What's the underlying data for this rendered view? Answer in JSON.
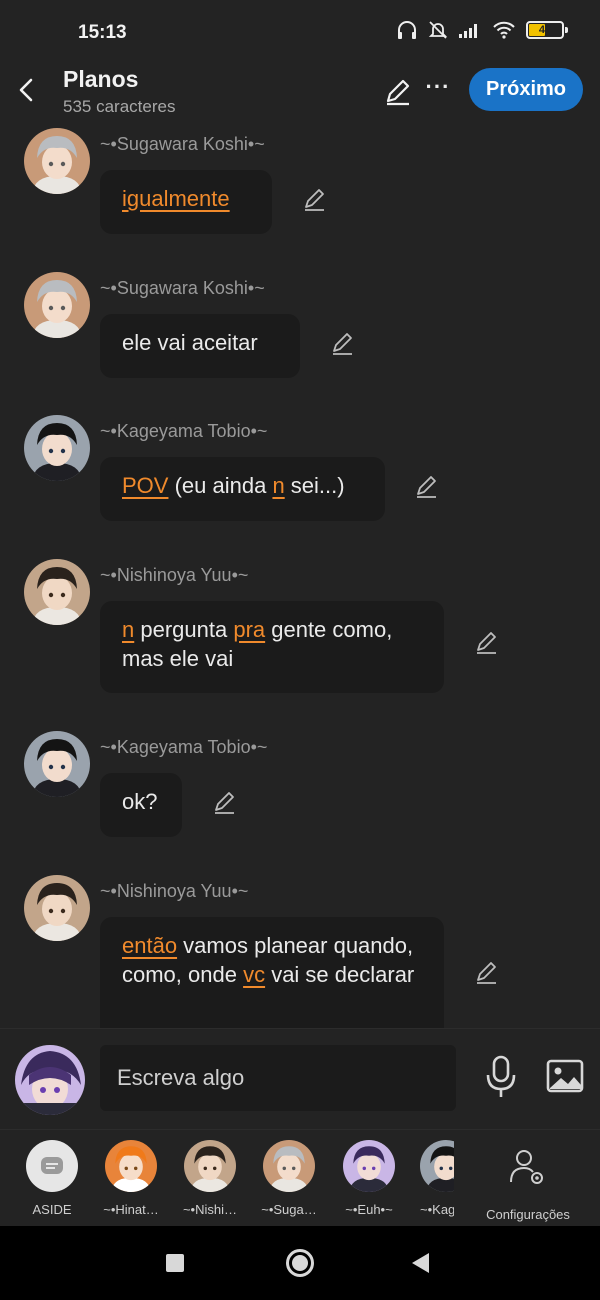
{
  "status": {
    "time": "15:13",
    "battery": "47",
    "battery_level": 0.47
  },
  "header": {
    "title": "Planos",
    "subtitle": "535 caracteres",
    "next_label": "Próximo"
  },
  "messages": [
    {
      "sender": "~•Sugawara Koshi•~",
      "avatar": "sugawara-avatar",
      "parts": [
        {
          "text": "igualmente",
          "hl": true
        }
      ]
    },
    {
      "sender": "~•Sugawara Koshi•~",
      "avatar": "sugawara-avatar",
      "parts": [
        {
          "text": "ele vai aceitar",
          "hl": false
        }
      ]
    },
    {
      "sender": "~•Kageyama Tobio•~",
      "avatar": "kageyama-avatar",
      "parts": [
        {
          "text": "POV",
          "hl": true
        },
        {
          "text": " (eu ainda ",
          "hl": false
        },
        {
          "text": "n",
          "hl": true
        },
        {
          "text": " sei...)",
          "hl": false
        }
      ]
    },
    {
      "sender": "~•Nishinoya Yuu•~",
      "avatar": "nishinoya-avatar",
      "parts": [
        {
          "text": "n",
          "hl": true
        },
        {
          "text": " pergunta ",
          "hl": false
        },
        {
          "text": "pra",
          "hl": true
        },
        {
          "text": " gente como, mas ele vai",
          "hl": false
        }
      ]
    },
    {
      "sender": "~•Kageyama Tobio•~",
      "avatar": "kageyama-avatar",
      "parts": [
        {
          "text": "ok?",
          "hl": false
        }
      ]
    },
    {
      "sender": "~•Nishinoya Yuu•~",
      "avatar": "nishinoya-avatar",
      "parts": [
        {
          "text": "então",
          "hl": true
        },
        {
          "text": " vamos planear quando, como, onde ",
          "hl": false
        },
        {
          "text": "vc",
          "hl": true
        },
        {
          "text": " vai se declarar",
          "hl": false
        }
      ]
    }
  ],
  "composer": {
    "placeholder": "Escreva algo"
  },
  "tabs": [
    {
      "label": "ASIDE",
      "icon": "chat-bubble-icon"
    },
    {
      "label": "~•Hinat…",
      "icon": "hinata-avatar"
    },
    {
      "label": "~•Nishi…",
      "icon": "nishinoya-avatar"
    },
    {
      "label": "~•Suga…",
      "icon": "sugawara-avatar"
    },
    {
      "label": "~•Euh•~",
      "icon": "euh-avatar"
    },
    {
      "label": "~•Kag",
      "icon": "kageyama-avatar"
    }
  ],
  "config_label": "Configurações",
  "colors": {
    "accent": "#1a73c7",
    "highlight": "#f08a2c",
    "background": "#232323",
    "bubble": "#1b1b1b"
  }
}
